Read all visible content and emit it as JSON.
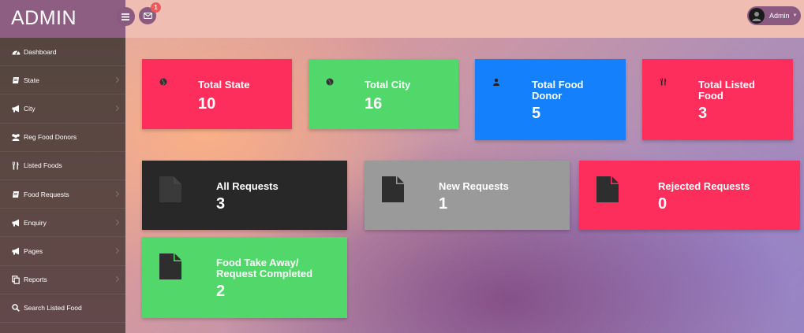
{
  "header": {
    "brand": "ADMIN",
    "mail_badge": "1",
    "user_name": "Admin"
  },
  "sidebar": {
    "items": [
      {
        "label": "Dashboard",
        "icon": "dashboard-icon",
        "has_arrow": false
      },
      {
        "label": "State",
        "icon": "book-icon",
        "has_arrow": true
      },
      {
        "label": "City",
        "icon": "bullhorn-icon",
        "has_arrow": true
      },
      {
        "label": "Reg Food Donors",
        "icon": "users-icon",
        "has_arrow": false
      },
      {
        "label": "Listed Foods",
        "icon": "cutlery-icon",
        "has_arrow": false
      },
      {
        "label": "Food Requests",
        "icon": "book-icon",
        "has_arrow": true
      },
      {
        "label": "Enquiry",
        "icon": "bullhorn-icon",
        "has_arrow": true
      },
      {
        "label": "Pages",
        "icon": "bullhorn-icon",
        "has_arrow": true
      },
      {
        "label": "Reports",
        "icon": "copy-icon",
        "has_arrow": true
      },
      {
        "label": "Search Listed Food",
        "icon": "search-icon",
        "has_arrow": false
      }
    ]
  },
  "cards": {
    "total_state": {
      "title": "Total State",
      "count": "10",
      "icon": "globe-icon",
      "color": "#fd2e5c"
    },
    "total_city": {
      "title": "Total City",
      "count": "16",
      "icon": "globe-icon",
      "color": "#52d86a"
    },
    "total_food_donor": {
      "title_line1": "Total Food",
      "title_line2": "Donor",
      "count": "5",
      "icon": "user-icon",
      "color": "#1580fb"
    },
    "total_listed_food": {
      "title_line1": "Total Listed",
      "title_line2": "Food",
      "count": "3",
      "icon": "cutlery-icon",
      "color": "#fd2e5c"
    },
    "all_requests": {
      "title": "All Requests",
      "count": "3",
      "icon": "file-icon",
      "color": "#282828"
    },
    "new_requests": {
      "title": "New Requests",
      "count": "1",
      "icon": "file-icon",
      "color": "#9a9a9a"
    },
    "rejected_requests": {
      "title": "Rejected Requests",
      "count": "0",
      "icon": "file-icon",
      "color": "#fd2e5c"
    },
    "food_takeaway": {
      "title_line1": "Food Take Away/",
      "title_line2": "Request Completed",
      "count": "2",
      "icon": "file-icon",
      "color": "#52d86a"
    }
  }
}
